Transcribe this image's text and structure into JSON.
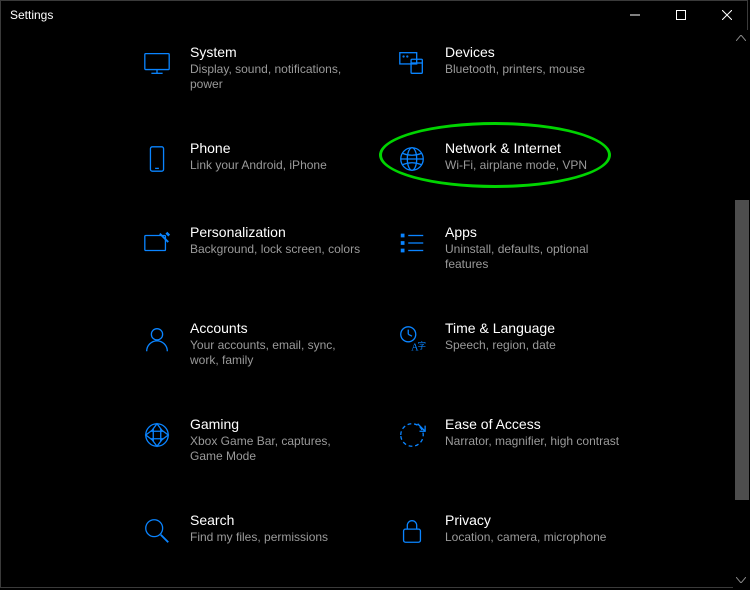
{
  "window": {
    "title": "Settings"
  },
  "colors": {
    "accent": "#0a84ff",
    "highlight": "#00d400"
  },
  "highlighted_item_index": 3,
  "categories": [
    {
      "id": "system",
      "icon": "system-icon",
      "title": "System",
      "desc": "Display, sound, notifications, power"
    },
    {
      "id": "devices",
      "icon": "devices-icon",
      "title": "Devices",
      "desc": "Bluetooth, printers, mouse"
    },
    {
      "id": "phone",
      "icon": "phone-icon",
      "title": "Phone",
      "desc": "Link your Android, iPhone"
    },
    {
      "id": "network",
      "icon": "network-icon",
      "title": "Network & Internet",
      "desc": "Wi-Fi, airplane mode, VPN"
    },
    {
      "id": "personalization",
      "icon": "personalization-icon",
      "title": "Personalization",
      "desc": "Background, lock screen, colors"
    },
    {
      "id": "apps",
      "icon": "apps-icon",
      "title": "Apps",
      "desc": "Uninstall, defaults, optional features"
    },
    {
      "id": "accounts",
      "icon": "accounts-icon",
      "title": "Accounts",
      "desc": "Your accounts, email, sync, work, family"
    },
    {
      "id": "time-language",
      "icon": "time-language-icon",
      "title": "Time & Language",
      "desc": "Speech, region, date"
    },
    {
      "id": "gaming",
      "icon": "gaming-icon",
      "title": "Gaming",
      "desc": "Xbox Game Bar, captures, Game Mode"
    },
    {
      "id": "ease-of-access",
      "icon": "ease-of-access-icon",
      "title": "Ease of Access",
      "desc": "Narrator, magnifier, high contrast"
    },
    {
      "id": "search",
      "icon": "search-icon",
      "title": "Search",
      "desc": "Find my files, permissions"
    },
    {
      "id": "privacy",
      "icon": "privacy-icon",
      "title": "Privacy",
      "desc": "Location, camera, microphone"
    }
  ]
}
